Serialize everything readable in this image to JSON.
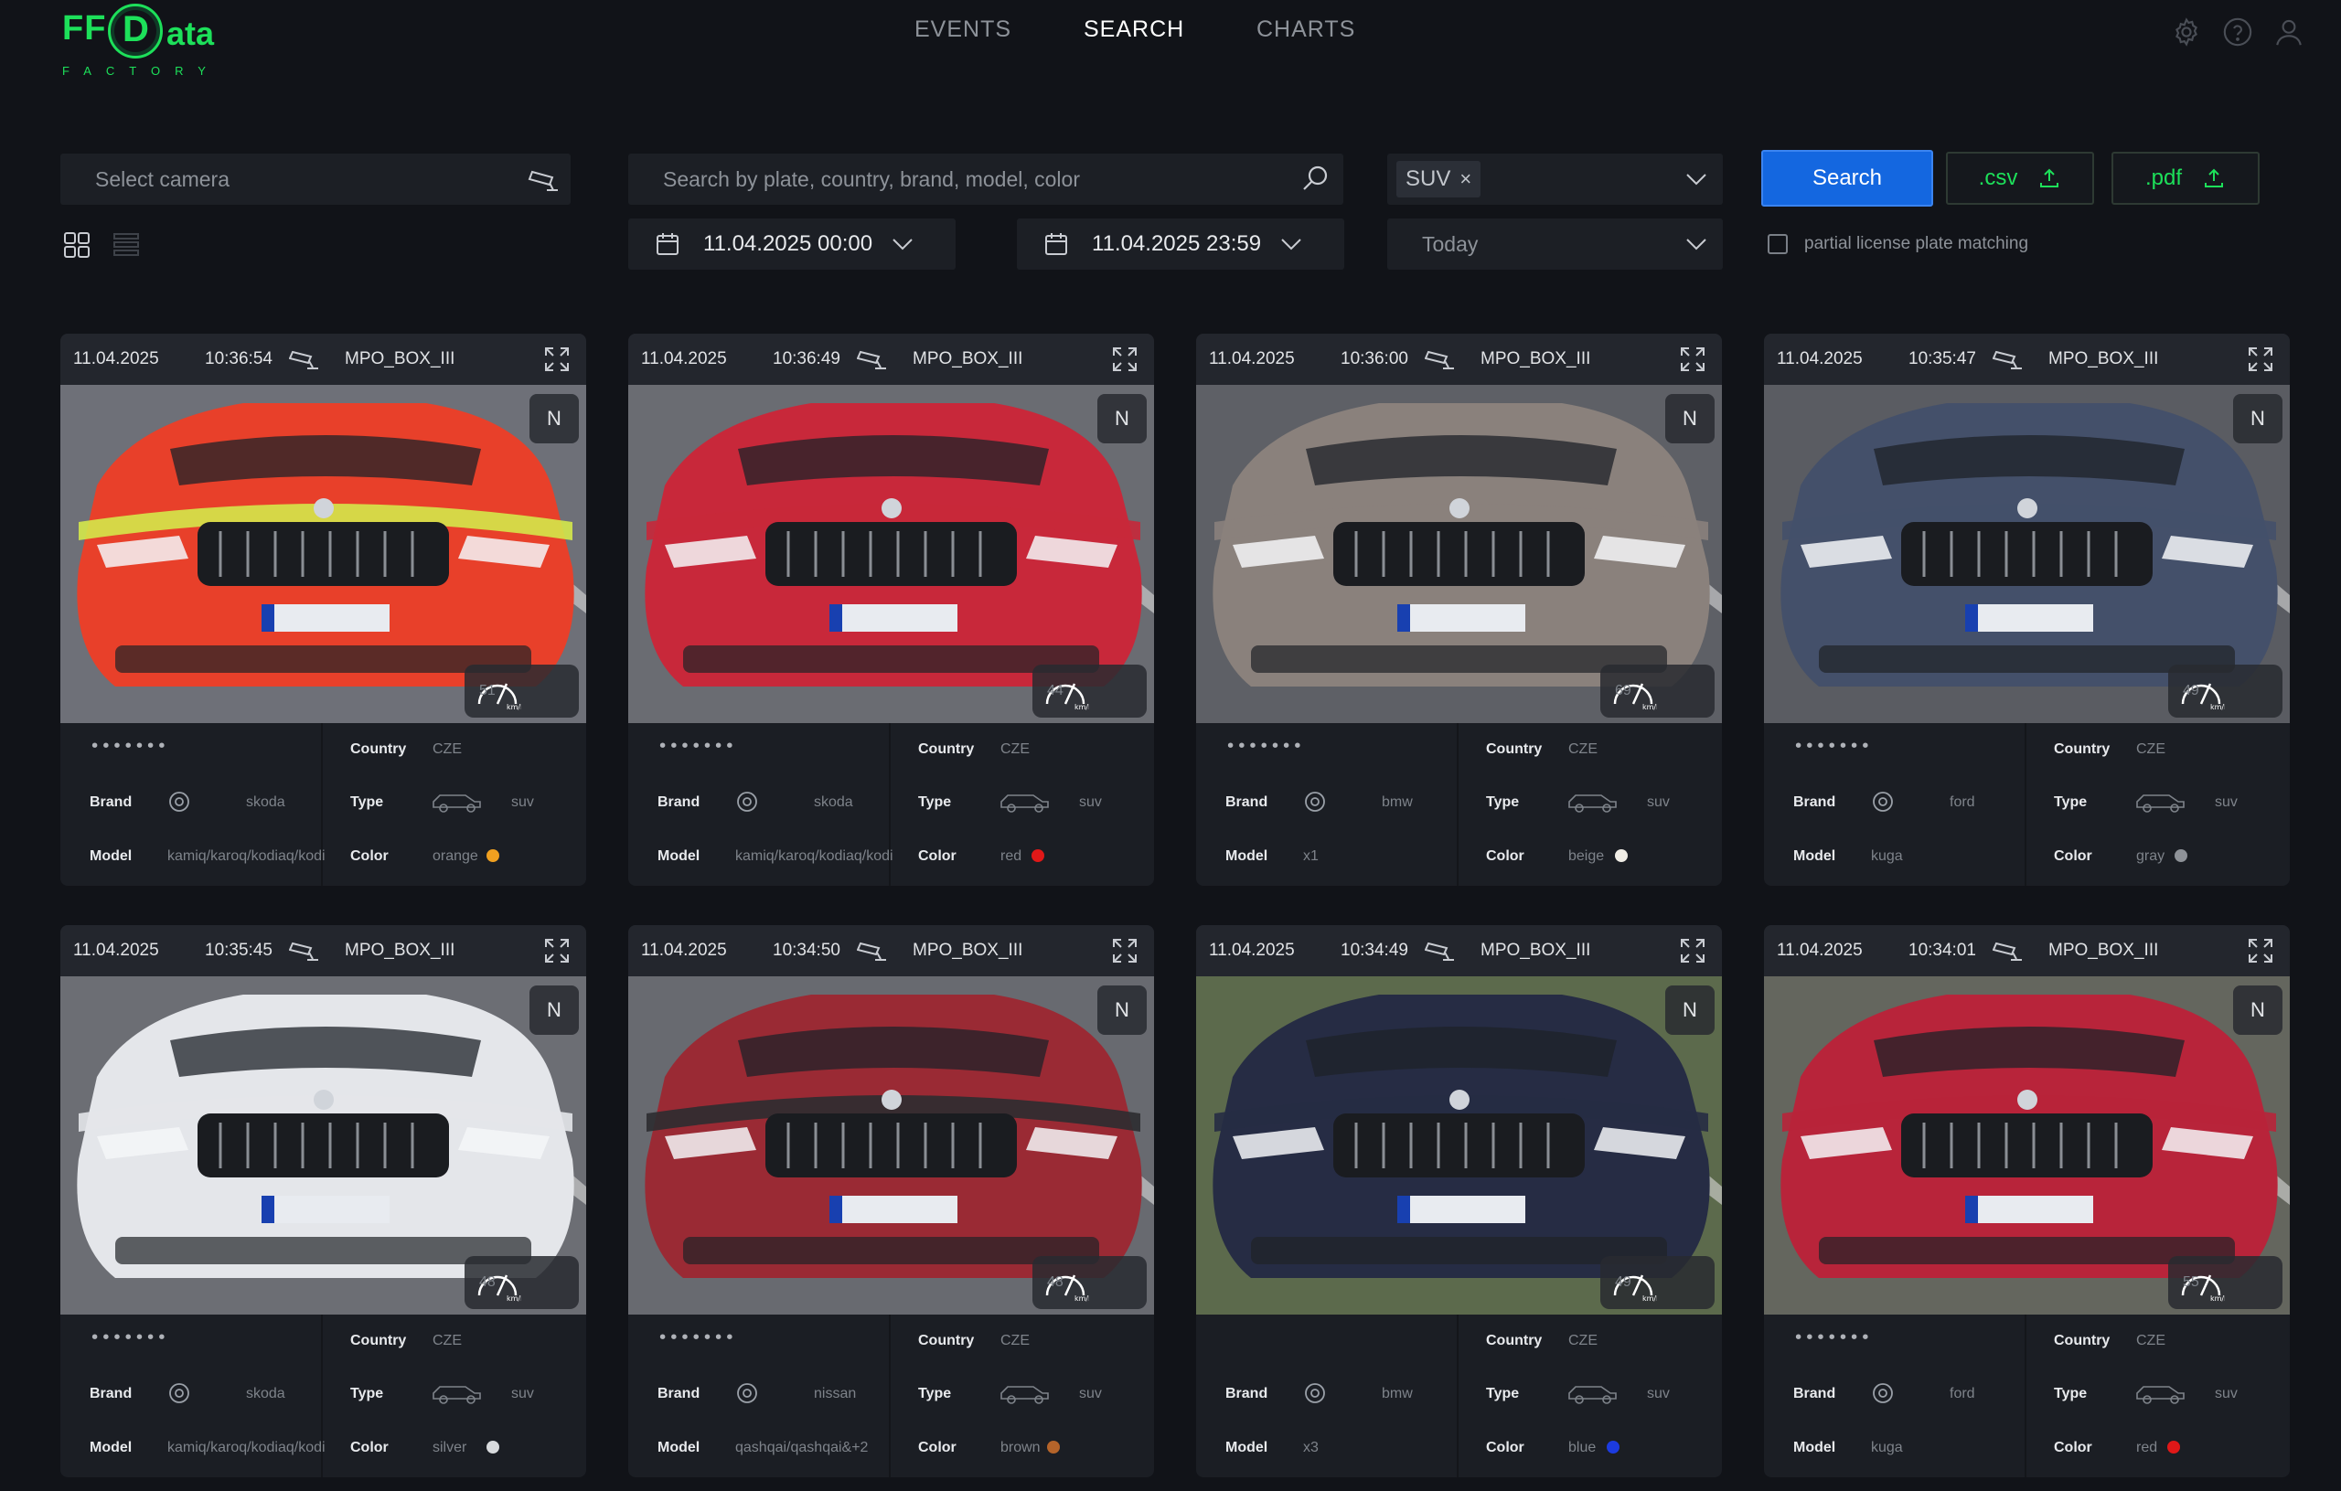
{
  "header": {
    "logo_ff": "FF",
    "logo_d": "D",
    "logo_ata": "ata",
    "logo_sub": "FACTORY",
    "nav": [
      {
        "label": "EVENTS",
        "active": false
      },
      {
        "label": "SEARCH",
        "active": true
      },
      {
        "label": "CHARTS",
        "active": false
      }
    ],
    "icons": [
      "gear-icon",
      "help-icon",
      "user-icon"
    ]
  },
  "filters": {
    "camera_placeholder": "Select camera",
    "search_placeholder": "Search by plate, country, brand, model, color",
    "type_tag": "SUV",
    "date_from": "11.04.2025 00:00",
    "date_to": "11.04.2025 23:59",
    "period": "Today",
    "search_button": "Search",
    "csv_button": ".csv",
    "pdf_button": ".pdf",
    "partial_match_label": "partial license plate matching"
  },
  "labels": {
    "country": "Country",
    "brand": "Brand",
    "type": "Type",
    "model": "Model",
    "color": "Color",
    "n": "N"
  },
  "cards": [
    {
      "date": "11.04.2025",
      "time": "10:36:54",
      "camera": "MPO_BOX_III",
      "speed": "51",
      "plate": "•••••••",
      "country": "CZE",
      "brand": "skoda",
      "type": "suv",
      "model": "kamiq/karoq/kodiaq/kodi",
      "color": "orange",
      "color_hex": "#f0a020",
      "car_body": "#e8402a",
      "car_accent": "#d4e84a",
      "bg": "#6e7078"
    },
    {
      "date": "11.04.2025",
      "time": "10:36:49",
      "camera": "MPO_BOX_III",
      "speed": "44",
      "plate": "•••••••",
      "country": "CZE",
      "brand": "skoda",
      "type": "suv",
      "model": "kamiq/karoq/kodiaq/kodi",
      "color": "red",
      "color_hex": "#e01818",
      "car_body": "#c8283a",
      "car_accent": "#c8283a",
      "bg": "#6a6c72"
    },
    {
      "date": "11.04.2025",
      "time": "10:36:00",
      "camera": "MPO_BOX_III",
      "speed": "69",
      "plate": "•••••••",
      "country": "CZE",
      "brand": "bmw",
      "type": "suv",
      "model": "x1",
      "color": "beige",
      "color_hex": "#f0ede6",
      "car_body": "#8a817c",
      "car_accent": "#8a817c",
      "bg": "#5e6066"
    },
    {
      "date": "11.04.2025",
      "time": "10:35:47",
      "camera": "MPO_BOX_III",
      "speed": "49",
      "plate": "•••••••",
      "country": "CZE",
      "brand": "ford",
      "type": "suv",
      "model": "kuga",
      "color": "gray",
      "color_hex": "#8e9298",
      "car_body": "#44506a",
      "car_accent": "#44506a",
      "bg": "#5a5c62"
    },
    {
      "date": "11.04.2025",
      "time": "10:35:45",
      "camera": "MPO_BOX_III",
      "speed": "48",
      "plate": "•••••••",
      "country": "CZE",
      "brand": "skoda",
      "type": "suv",
      "model": "kamiq/karoq/kodiaq/kodi",
      "color": "silver",
      "color_hex": "#d8dadd",
      "car_body": "#e4e6ea",
      "car_accent": "#e4e6ea",
      "bg": "#6c6e74"
    },
    {
      "date": "11.04.2025",
      "time": "10:34:50",
      "camera": "MPO_BOX_III",
      "speed": "48",
      "plate": "•••••••",
      "country": "CZE",
      "brand": "nissan",
      "type": "suv",
      "model": "qashqai/qashqai&+2",
      "color": "brown",
      "color_hex": "#b5642a",
      "car_body": "#9a2a34",
      "car_accent": "#2c2c30",
      "bg": "#686a70"
    },
    {
      "date": "11.04.2025",
      "time": "10:34:49",
      "camera": "MPO_BOX_III",
      "speed": "49",
      "plate": "",
      "country": "CZE",
      "brand": "bmw",
      "type": "suv",
      "model": "x3",
      "color": "blue",
      "color_hex": "#1c3be0",
      "car_body": "#262c44",
      "car_accent": "#262c44",
      "bg": "#5c6a4c"
    },
    {
      "date": "11.04.2025",
      "time": "10:34:01",
      "camera": "MPO_BOX_III",
      "speed": "55",
      "plate": "•••••••",
      "country": "CZE",
      "brand": "ford",
      "type": "suv",
      "model": "kuga",
      "color": "red",
      "color_hex": "#e01818",
      "car_body": "#b8243a",
      "car_accent": "#b8243a",
      "bg": "#64665e"
    }
  ]
}
